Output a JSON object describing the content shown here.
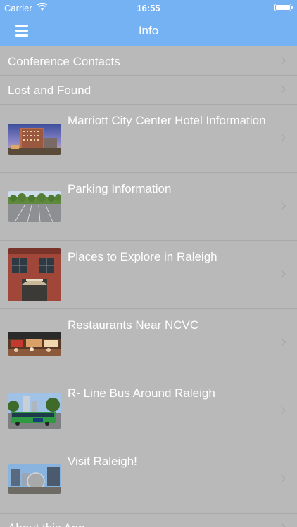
{
  "status_bar": {
    "carrier": "Carrier",
    "time": "16:55"
  },
  "nav": {
    "title": "Info",
    "menu_icon": "hamburger-menu-icon"
  },
  "list": {
    "simple_items": [
      {
        "label": "Conference Contacts"
      },
      {
        "label": "Lost and Found"
      }
    ],
    "media_items": [
      {
        "label": "Marriott City Center Hotel Information",
        "image": "hotel-photo"
      },
      {
        "label": "Parking Information",
        "image": "parking-lot-photo"
      },
      {
        "label": "Places to Explore in Raleigh",
        "image": "brick-building-photo"
      },
      {
        "label": "Restaurants Near NCVC",
        "image": "restaurant-photo"
      },
      {
        "label": "R- Line Bus Around Raleigh",
        "image": "bus-photo"
      },
      {
        "label": "Visit Raleigh!",
        "image": "city-sculpture-photo"
      }
    ],
    "footer_item": {
      "label": "About this App"
    }
  },
  "colors": {
    "accent": "#75b2f4",
    "list_bg": "#b9b9b9",
    "separator": "#a9a9a9"
  }
}
